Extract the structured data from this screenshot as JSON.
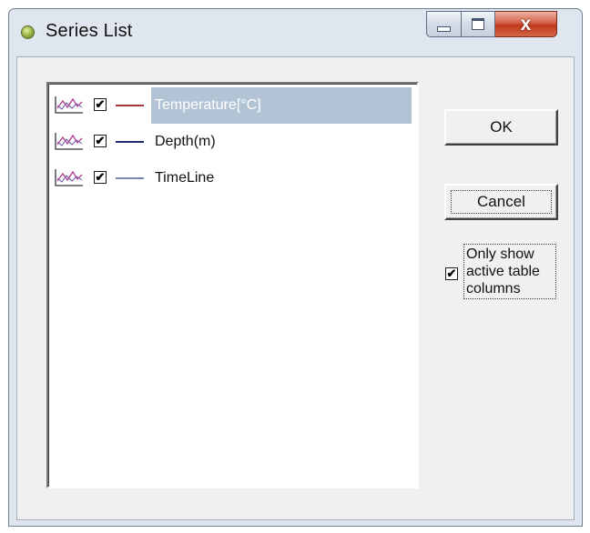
{
  "window": {
    "title": "Series List"
  },
  "titlebar_buttons": {
    "minimize_icon": "minimize-icon",
    "maximize_icon": "maximize-icon",
    "close_glyph": "x"
  },
  "series_list": {
    "items": [
      {
        "label": "Temperature[°C]",
        "checked": true,
        "line_color": "#a4373a",
        "selected": true
      },
      {
        "label": "Depth(m)",
        "checked": true,
        "line_color": "#1e2a6e",
        "selected": false
      },
      {
        "label": "TimeLine",
        "checked": true,
        "line_color": "#7b86b4",
        "selected": false
      }
    ]
  },
  "buttons": {
    "ok_label": "OK",
    "cancel_label": "Cancel"
  },
  "options": {
    "only_active_checked": true,
    "only_active_label_line1": "Only show",
    "only_active_label_line2": "active table",
    "only_active_label_line3": "columns"
  },
  "colors": {
    "selection": "#b3c3d6",
    "close_button": "#c7412a",
    "dialog_bg": "#f0f0f0"
  }
}
